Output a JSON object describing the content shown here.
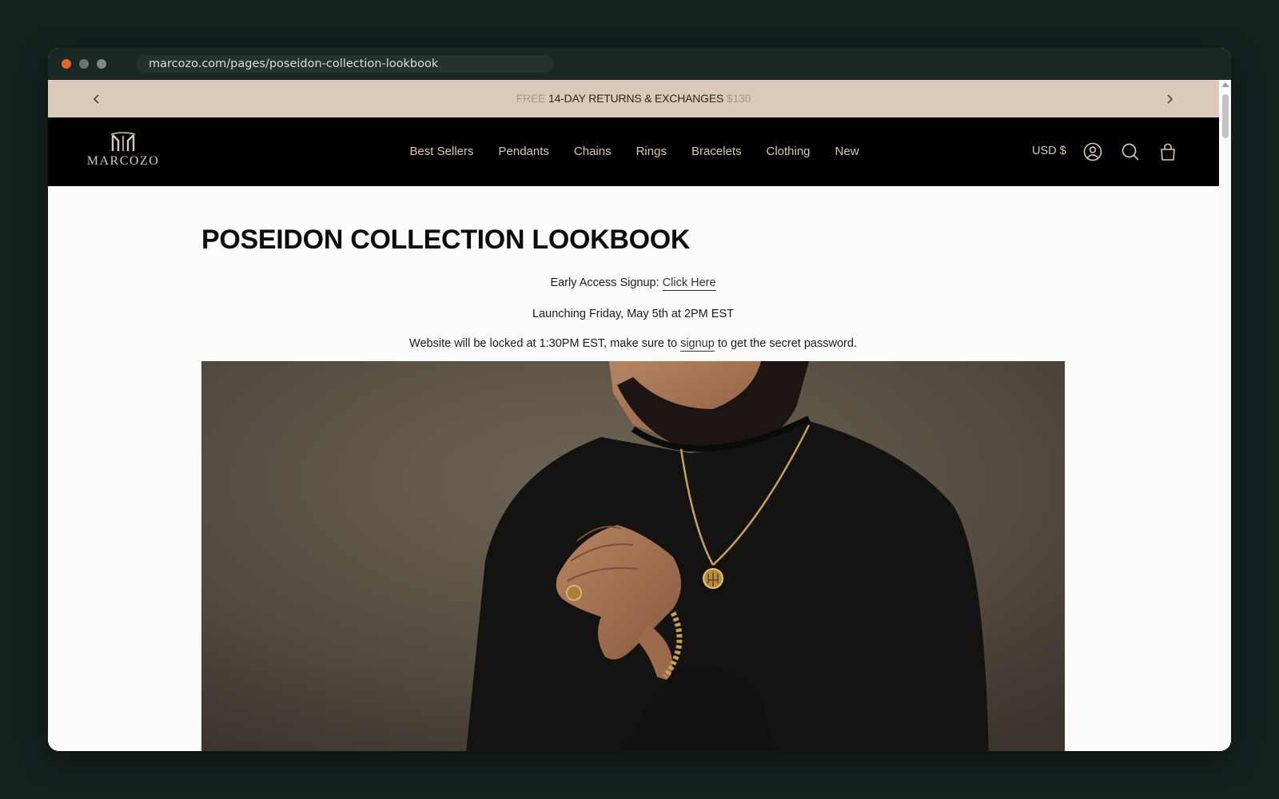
{
  "browser": {
    "url": "marcozo.com/pages/poseidon-collection-lookbook"
  },
  "announcement": {
    "prev_text": "FREE",
    "current_text": "14-DAY RETURNS & EXCHANGES",
    "next_text": "$130"
  },
  "header": {
    "logo_text": "MARCOZO",
    "nav": {
      "best_sellers": "Best Sellers",
      "pendants": "Pendants",
      "chains": "Chains",
      "rings": "Rings",
      "bracelets": "Bracelets",
      "clothing": "Clothing",
      "new": "New"
    },
    "currency": "USD $"
  },
  "page": {
    "title": "POSEIDON COLLECTION LOOKBOOK",
    "signup_prefix": "Early Access Signup: ",
    "signup_link": "Click Here",
    "launch_text": "Launching Friday, May 5th at 2PM EST",
    "lock_prefix": "Website will be locked at 1:30PM EST, make sure to ",
    "lock_link": "signup",
    "lock_suffix": " to get the secret password."
  },
  "colors": {
    "announcement_bg": "#dccab8",
    "header_bg": "#000000",
    "nav_text": "#d6c7b6",
    "page_bg": "#fdfcfa"
  },
  "icons": [
    "chevron-left-icon",
    "chevron-right-icon",
    "account-icon",
    "search-icon",
    "cart-icon"
  ]
}
